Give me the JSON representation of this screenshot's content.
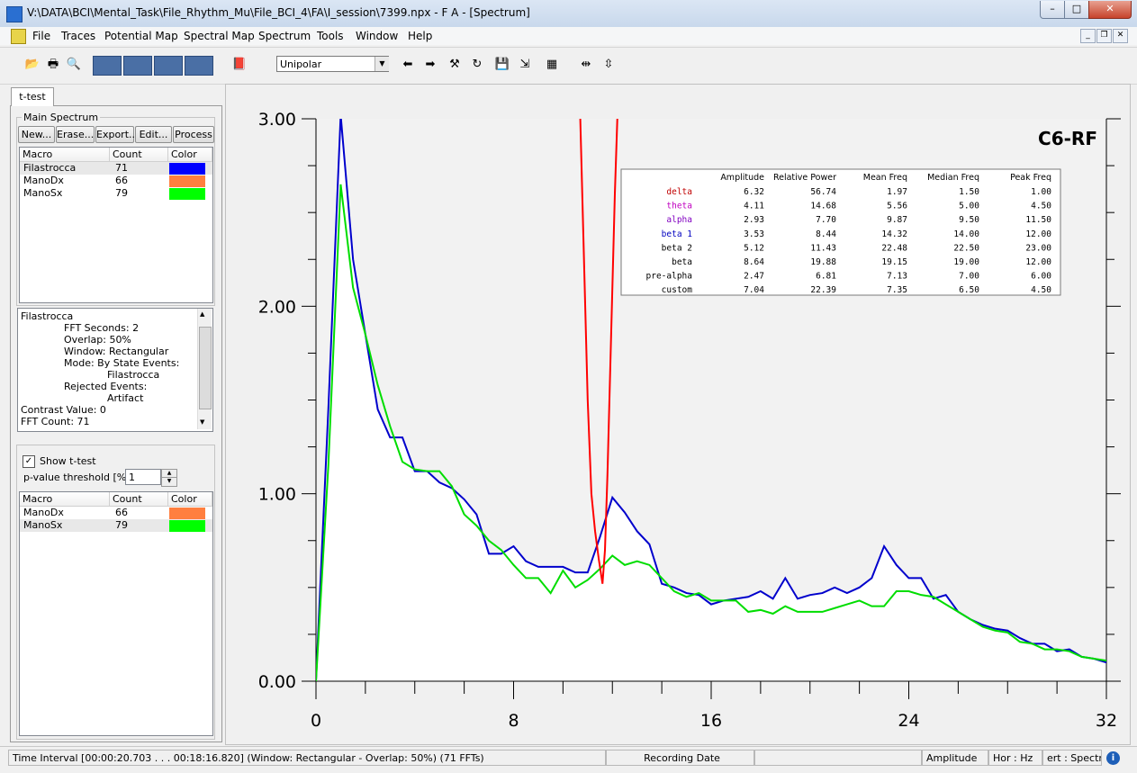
{
  "window": {
    "title": "V:\\DATA\\BCI\\Mental_Task\\File_Rhythm_Mu\\File_BCI_4\\FA\\I_session\\7399.npx - F A - [Spectrum]",
    "min": "–",
    "max": "□",
    "close": "✕"
  },
  "menu": {
    "items": [
      "File",
      "Traces",
      "Potential Map",
      "Spectral Map",
      "Spectrum",
      "Tools",
      "Window",
      "Help"
    ]
  },
  "toolbar": {
    "mode_value": "Unipolar",
    "icons": [
      "open-icon",
      "print-icon",
      "preview-icon",
      "traces-view-icon",
      "potential-map-icon",
      "spectral-map-icon",
      "spectrum-view-icon",
      "book-icon",
      "back-arrow-icon",
      "forward-arrow-icon",
      "tools-icon",
      "refresh-icon",
      "save-icon",
      "export-icon",
      "grid-icon",
      "zoom-x-icon",
      "zoom-y-icon"
    ]
  },
  "left_panel": {
    "tab": "t-test",
    "main_spectrum": {
      "title": "Main Spectrum",
      "buttons": [
        "New...",
        "Erase...",
        "Export...",
        "Edit...",
        "Process"
      ],
      "headers": [
        "Macro",
        "Count",
        "Color"
      ],
      "rows": [
        {
          "macro": "Filastrocca",
          "count": "71",
          "color": "#0000ff"
        },
        {
          "macro": "ManoDx",
          "count": "66",
          "color": "#ff7f3f"
        },
        {
          "macro": "ManoSx",
          "count": "79",
          "color": "#00ff00"
        }
      ]
    },
    "info": {
      "lines": [
        "Filastrocca",
        "FFT Seconds: 2",
        "Overlap: 50%",
        "Window: Rectangular",
        "Mode: By State Events:",
        "Filastrocca",
        "Rejected Events:",
        "Artifact",
        "Contrast Value: 0",
        "FFT Count: 71"
      ]
    },
    "ttest": {
      "show_label": "Show t-test",
      "show_checked": true,
      "threshold_label": "p-value threshold [%]",
      "threshold_value": "1",
      "headers": [
        "Macro",
        "Count",
        "Color"
      ],
      "rows": [
        {
          "macro": "ManoDx",
          "count": "66",
          "color": "#ff7f3f"
        },
        {
          "macro": "ManoSx",
          "count": "79",
          "color": "#00ff00"
        }
      ]
    }
  },
  "chart_data": {
    "type": "line",
    "title": "C6-RF",
    "xlim": [
      0,
      32
    ],
    "ylim": [
      0,
      3
    ],
    "x_ticks": [
      "0",
      "8",
      "16",
      "24",
      "32"
    ],
    "y_ticks": [
      "0.00",
      "1.00",
      "2.00",
      "3.00"
    ],
    "series": [
      {
        "color": "#0000cc",
        "x": [
          0,
          0.5,
          1,
          1.5,
          2,
          2.5,
          3,
          3.5,
          4,
          4.5,
          5,
          5.5,
          6,
          6.5,
          7,
          7.5,
          8,
          8.5,
          9,
          9.5,
          10,
          10.5,
          11,
          11.5,
          12,
          12.5,
          13,
          13.5,
          14,
          14.5,
          15,
          15.5,
          16,
          16.5,
          17,
          17.5,
          18,
          18.5,
          19,
          19.5,
          20,
          20.5,
          21,
          21.5,
          22,
          22.5,
          23,
          23.5,
          24,
          24.5,
          25,
          25.5,
          26,
          26.5,
          27,
          27.5,
          28,
          28.5,
          29,
          29.5,
          30,
          30.5,
          31,
          31.5,
          32
        ],
        "y": [
          0,
          1.45,
          3.02,
          2.25,
          1.85,
          1.45,
          1.3,
          1.3,
          1.12,
          1.12,
          1.06,
          1.03,
          0.97,
          0.89,
          0.68,
          0.68,
          0.72,
          0.64,
          0.61,
          0.61,
          0.61,
          0.58,
          0.58,
          0.77,
          0.98,
          0.9,
          0.8,
          0.73,
          0.52,
          0.5,
          0.47,
          0.46,
          0.41,
          0.43,
          0.44,
          0.45,
          0.48,
          0.44,
          0.55,
          0.44,
          0.46,
          0.47,
          0.5,
          0.47,
          0.5,
          0.55,
          0.72,
          0.62,
          0.55,
          0.55,
          0.44,
          0.46,
          0.37,
          0.33,
          0.3,
          0.28,
          0.27,
          0.23,
          0.2,
          0.2,
          0.16,
          0.17,
          0.13,
          0.12,
          0.1
        ]
      },
      {
        "color": "#00dd00",
        "x": [
          0,
          0.5,
          1,
          1.5,
          2,
          2.5,
          3,
          3.5,
          4,
          4.5,
          5,
          5.5,
          6,
          6.5,
          7,
          7.5,
          8,
          8.5,
          9,
          9.5,
          10,
          10.5,
          11,
          11.5,
          12,
          12.5,
          13,
          13.5,
          14,
          14.5,
          15,
          15.5,
          16,
          16.5,
          17,
          17.5,
          18,
          18.5,
          19,
          19.5,
          20,
          20.5,
          21,
          21.5,
          22,
          22.5,
          23,
          23.5,
          24,
          24.5,
          25,
          25.5,
          26,
          26.5,
          27,
          27.5,
          28,
          28.5,
          29,
          29.5,
          30,
          30.5,
          31,
          31.5,
          32
        ],
        "y": [
          0,
          1.15,
          2.65,
          2.1,
          1.85,
          1.58,
          1.36,
          1.17,
          1.13,
          1.12,
          1.12,
          1.04,
          0.89,
          0.83,
          0.75,
          0.7,
          0.62,
          0.55,
          0.55,
          0.47,
          0.59,
          0.5,
          0.54,
          0.6,
          0.67,
          0.62,
          0.64,
          0.62,
          0.55,
          0.48,
          0.45,
          0.47,
          0.43,
          0.43,
          0.43,
          0.37,
          0.38,
          0.36,
          0.4,
          0.37,
          0.37,
          0.37,
          0.39,
          0.41,
          0.43,
          0.4,
          0.4,
          0.48,
          0.48,
          0.46,
          0.45,
          0.41,
          0.37,
          0.33,
          0.29,
          0.27,
          0.26,
          0.21,
          0.2,
          0.17,
          0.17,
          0.16,
          0.13,
          0.12,
          0.11
        ]
      },
      {
        "color": "#ff0000",
        "x": [
          10.7,
          10.8,
          10.9,
          11.0,
          11.15,
          11.3,
          11.45,
          11.6,
          11.7,
          11.8,
          11.9,
          12.0,
          12.1,
          12.2
        ],
        "y": [
          3.0,
          2.5,
          2.0,
          1.5,
          1.0,
          0.8,
          0.65,
          0.52,
          0.7,
          1.1,
          1.6,
          2.1,
          2.6,
          3.0
        ]
      }
    ],
    "shaded_region": [
      4,
      32
    ],
    "table": {
      "headers": [
        "",
        "Amplitude",
        "Relative Power",
        "Mean Freq",
        "Median Freq",
        "Peak Freq"
      ],
      "rows": [
        {
          "band": "delta",
          "color": "#c00000",
          "values": [
            "6.32",
            "56.74",
            "1.97",
            "1.50",
            "1.00"
          ]
        },
        {
          "band": "theta",
          "color": "#c000c0",
          "values": [
            "4.11",
            "14.68",
            "5.56",
            "5.00",
            "4.50"
          ]
        },
        {
          "band": "alpha",
          "color": "#8000c0",
          "values": [
            "2.93",
            "7.70",
            "9.87",
            "9.50",
            "11.50"
          ]
        },
        {
          "band": "beta 1",
          "color": "#0000c0",
          "values": [
            "3.53",
            "8.44",
            "14.32",
            "14.00",
            "12.00"
          ]
        },
        {
          "band": "beta 2",
          "color": "#000000",
          "values": [
            "5.12",
            "11.43",
            "22.48",
            "22.50",
            "23.00"
          ]
        },
        {
          "band": "beta",
          "color": "#000000",
          "values": [
            "8.64",
            "19.88",
            "19.15",
            "19.00",
            "12.00"
          ]
        },
        {
          "band": "pre-alpha",
          "color": "#000000",
          "values": [
            "2.47",
            "6.81",
            "7.13",
            "7.00",
            "6.00"
          ]
        },
        {
          "band": "custom",
          "color": "#000000",
          "values": [
            "7.04",
            "22.39",
            "7.35",
            "6.50",
            "4.50"
          ]
        }
      ]
    }
  },
  "status": {
    "time_interval": "Time Interval [00:00:20.703 . . . 00:18:16.820] (Window: Rectangular - Overlap: 50%) (71 FFTs)",
    "recording_date": "Recording Date",
    "blank": "",
    "amplitude": "Amplitude",
    "hor": "Hor : Hz",
    "vert": "ert : Spectru"
  }
}
